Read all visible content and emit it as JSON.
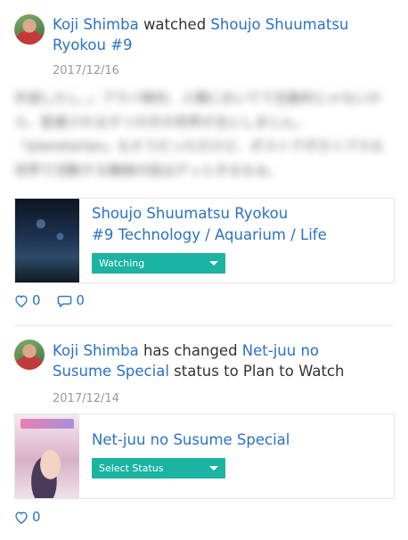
{
  "activities": [
    {
      "user": "Koji Shimba",
      "verb": "watched",
      "work_episode": "Shoujo Shuumatsu Ryokou #9",
      "date": "2017/12/16",
      "comment": "ㅡ\"ㅡ — (blurred comment text)",
      "card": {
        "title": "Shoujo Shuumatsu Ryokou",
        "subtitle": "#9  Technology / Aquarium / Life",
        "status": "Watching"
      },
      "likes": "0",
      "comments": "0"
    },
    {
      "user": "Koji Shimba",
      "verb": "has changed",
      "work": "Net-juu no Susume Special",
      "status_change_text": "status to Plan to Watch",
      "date": "2017/12/14",
      "card": {
        "title": "Net-juu no Susume Special",
        "status": "Select Status"
      },
      "likes": "0"
    }
  ],
  "icons": {
    "like": "heart-icon",
    "comment": "comment-bubble-icon",
    "dropdown": "caret-down-icon"
  },
  "colors": {
    "link": "#2a72c6",
    "status_button": "#1bb3a1",
    "date": "#999999"
  }
}
